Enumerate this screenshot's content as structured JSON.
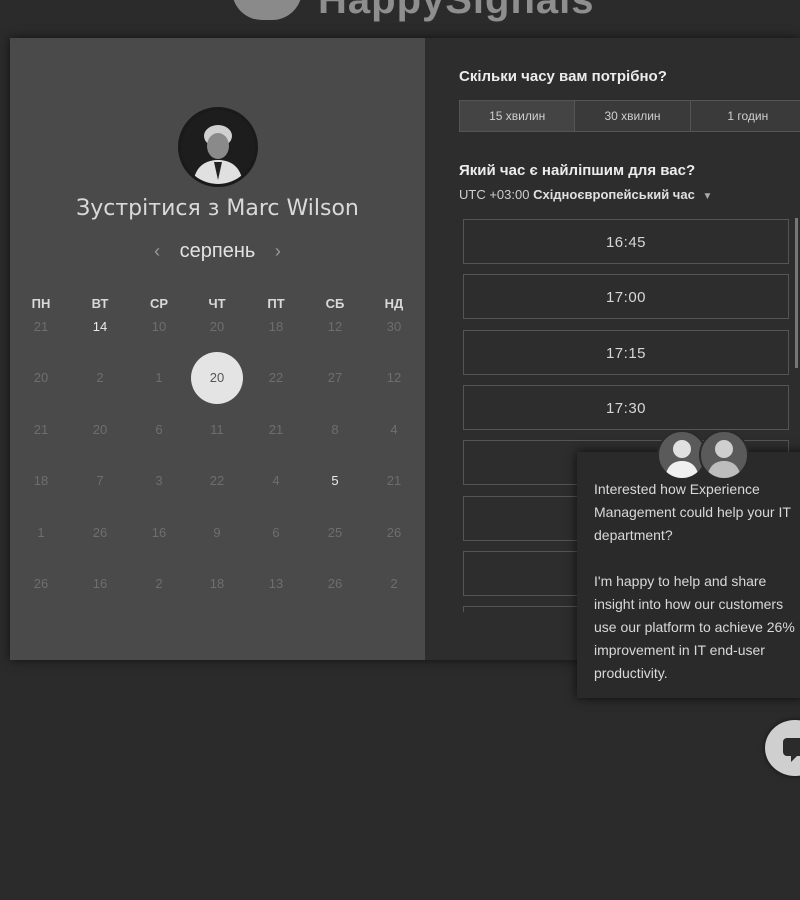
{
  "brand": {
    "logo_text": "HappySignals"
  },
  "host": {
    "meet_title": "Зустрітися з Marc Wilson",
    "avatar_icon": "person-avatar"
  },
  "calendar": {
    "month": "серпень",
    "prev_icon": "chevron-left-icon",
    "next_icon": "chevron-right-icon",
    "weekdays": [
      "ПН",
      "ВТ",
      "СР",
      "ЧТ",
      "ПТ",
      "СБ",
      "НД"
    ],
    "weeks": [
      [
        "21",
        "14",
        "10",
        "20",
        "18",
        "12",
        "30"
      ],
      [
        "20",
        "2",
        "1",
        "20",
        "22",
        "27",
        "12"
      ],
      [
        "21",
        "20",
        "6",
        "11",
        "21",
        "8",
        "4"
      ],
      [
        "18",
        "7",
        "3",
        "22",
        "4",
        "5",
        "21"
      ],
      [
        "1",
        "26",
        "16",
        "9",
        "6",
        "25",
        "26"
      ],
      [
        "26",
        "16",
        "2",
        "18",
        "13",
        "26",
        "2"
      ]
    ],
    "available": [
      [
        0,
        1
      ],
      [
        3,
        5
      ]
    ],
    "selected": [
      1,
      3
    ]
  },
  "duration": {
    "title": "Скільки часу вам потрібно?",
    "options": [
      "15 хвилин",
      "30 хвилин",
      "1 годин"
    ],
    "active_index": 0
  },
  "timepicker": {
    "title": "Який час є найліпшим для вас?",
    "tz_offset": "UTC +03:00",
    "tz_name": "Східноєвропейський час",
    "slots": [
      "16:45",
      "17:00",
      "17:15",
      "17:30",
      "",
      "",
      "",
      ""
    ]
  },
  "chat": {
    "paragraph1": "Interested how Experience Management could help your IT department?",
    "paragraph2": "I'm happy to help and share insight into how our customers use our platform to achieve 26% improvement in IT end-user productivity.",
    "launcher_icon": "chat-bubble-icon"
  }
}
